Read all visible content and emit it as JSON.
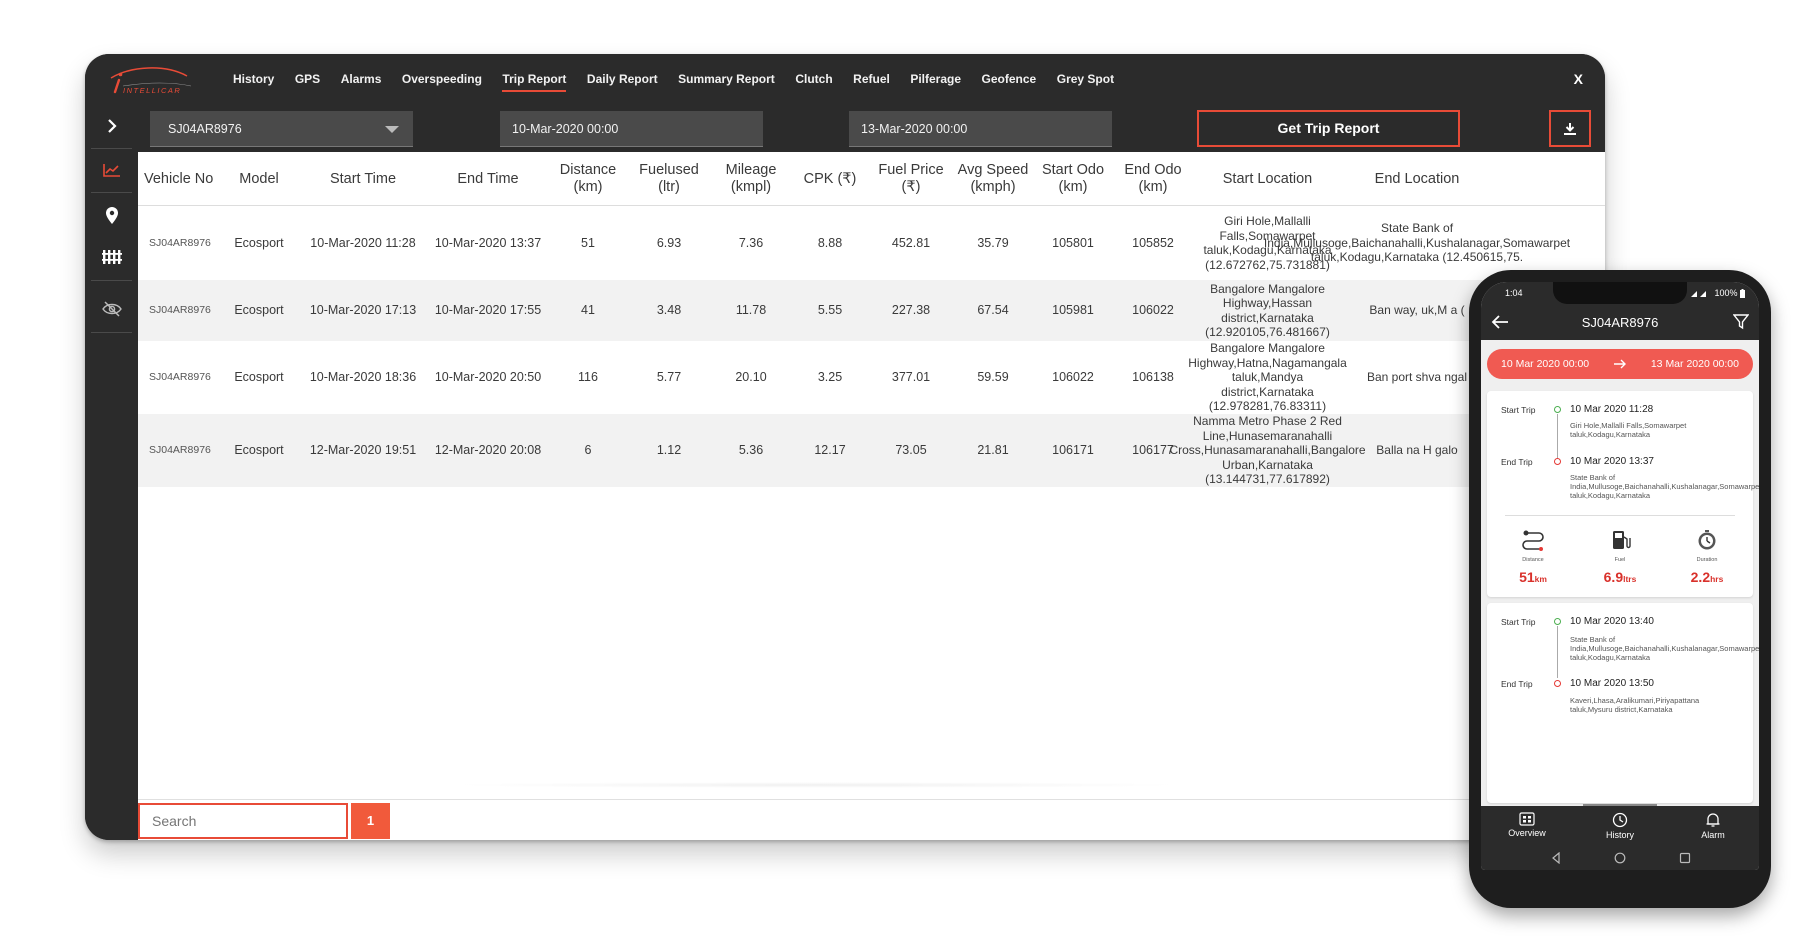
{
  "app": {
    "brand": "INTELLICAR",
    "nav": [
      "History",
      "GPS",
      "Alarms",
      "Overspeeding",
      "Trip Report",
      "Daily Report",
      "Summary Report",
      "Clutch",
      "Refuel",
      "Pilferage",
      "Geofence",
      "Grey Spot"
    ],
    "active_nav": "Trip Report",
    "close_label": "X",
    "accent_color": "#e84b37"
  },
  "sidebar": {
    "icons": [
      "chevron-right-icon",
      "chart-line-icon",
      "location-pin-icon",
      "fence-icon",
      "hidden-eye-icon"
    ],
    "active": "chart-line-icon"
  },
  "filters": {
    "vehicle": "SJ04AR8976",
    "start_date": "10-Mar-2020 00:00",
    "end_date": "13-Mar-2020 00:00",
    "get_report_label": "Get Trip Report",
    "download_icon": "download-icon"
  },
  "table": {
    "headers": [
      "Vehicle No",
      "Model",
      "Start Time",
      "End Time",
      "Distance (km)",
      "Fuelused (ltr)",
      "Mileage (kmpl)",
      "CPK (₹)",
      "Fuel Price (₹)",
      "Avg Speed (kmph)",
      "Start Odo (km)",
      "End Odo (km)",
      "Start Location",
      "End Location"
    ],
    "rows": [
      [
        "SJ04AR8976",
        "Ecosport",
        "10-Mar-2020 11:28",
        "10-Mar-2020 13:37",
        "51",
        "6.93",
        "7.36",
        "8.88",
        "452.81",
        "35.79",
        "105801",
        "105852",
        "Giri Hole,Mallalli Falls,Somawarpet taluk,Kodagu,Karnataka (12.672762,75.731881)",
        "State Bank of India,Mullusoge,Baichanahalli,Kushalanagar,Somawarpet taluk,Kodagu,Karnataka (12.450615,75."
      ],
      [
        "SJ04AR8976",
        "Ecosport",
        "10-Mar-2020 17:13",
        "10-Mar-2020 17:55",
        "41",
        "3.48",
        "11.78",
        "5.55",
        "227.38",
        "67.54",
        "105981",
        "106022",
        "Bangalore Mangalore Highway,Hassan district,Karnataka (12.920105,76.481667)",
        "Ban way, uk,M a ("
      ],
      [
        "SJ04AR8976",
        "Ecosport",
        "10-Mar-2020 18:36",
        "10-Mar-2020 20:50",
        "116",
        "5.77",
        "20.10",
        "3.25",
        "377.01",
        "59.59",
        "106022",
        "106138",
        "Bangalore Mangalore Highway,Hatna,Nagamangala taluk,Mandya district,Karnataka (12.978281,76.83311)",
        "Ban port shva ngal"
      ],
      [
        "SJ04AR8976",
        "Ecosport",
        "12-Mar-2020 19:51",
        "12-Mar-2020 20:08",
        "6",
        "1.12",
        "5.36",
        "12.17",
        "73.05",
        "21.81",
        "106171",
        "106177",
        "Namma Metro Phase 2 Red Line,Hunasemaranahalli Cross,Hunasamaranahalli,Bangalore Urban,Karnataka (13.144731,77.617892)",
        "Balla na H galo"
      ]
    ]
  },
  "footer": {
    "search_placeholder": "Search",
    "page": "1"
  },
  "phone": {
    "status_time": "1:04",
    "battery": "100%",
    "title": "SJ04AR8976",
    "range_start": "10 Mar 2020 00:00",
    "range_end": "13 Mar 2020 00:00",
    "trips": [
      {
        "start_label": "Start Trip",
        "start_time": "10 Mar 2020 11:28",
        "start_addr": "Giri Hole,Mallalli Falls,Somawarpet taluk,Kodagu,Karnataka",
        "end_label": "End Trip",
        "end_time": "10 Mar 2020 13:37",
        "end_addr": "State Bank of India,Mullusoge,Baichanahalli,Kushalanagar,Somawarpet taluk,Kodagu,Karnataka",
        "stats": [
          {
            "label": "Distance",
            "value": "51",
            "unit": "km",
            "icon": "route-icon"
          },
          {
            "label": "Fuel",
            "value": "6.9",
            "unit": "ltrs",
            "icon": "fuel-pump-icon"
          },
          {
            "label": "Duration",
            "value": "2.2",
            "unit": "hrs",
            "icon": "stopwatch-icon"
          }
        ]
      },
      {
        "start_label": "Start Trip",
        "start_time": "10 Mar 2020 13:40",
        "start_addr": "State Bank of India,Mullusoge,Baichanahalli,Kushalanagar,Somawarpet taluk,Kodagu,Karnataka",
        "end_label": "End Trip",
        "end_time": "10 Mar 2020 13:50",
        "end_addr": "Kaveri,Lhasa,Aralikumari,Piriyapattana taluk,Mysuru district,Karnataka"
      }
    ],
    "tabs": [
      "Overview",
      "History",
      "Alarm"
    ]
  }
}
